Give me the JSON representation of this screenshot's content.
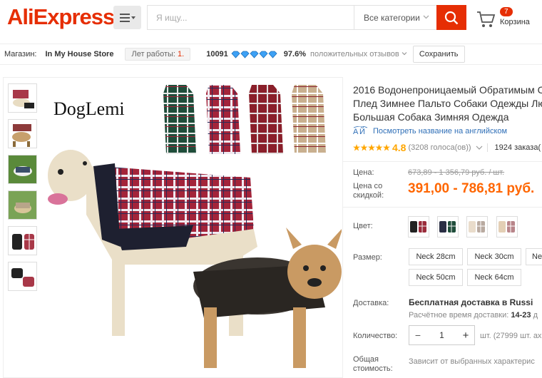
{
  "header": {
    "logo": "AliExpress",
    "logo_tm": "®",
    "search": {
      "placeholder": "Я ищу...",
      "category": "Все категории"
    },
    "cart": {
      "count": "7",
      "label": "Корзина"
    },
    "brand_color": "#e62e04"
  },
  "store": {
    "label": "Магазин:",
    "name": "In My House Store",
    "years_label": "Лет работы:",
    "years_value": "1",
    "score": "10091",
    "feedback_pct": "97.6%",
    "feedback_label": "положительных отзывов",
    "save": "Сохранить"
  },
  "gallery": {
    "brand_text": "DogLemi"
  },
  "product": {
    "title_lines": [
      "2016 Водонепроницаемый Обратимым С",
      "Плед Зимнее Пальто Собаки Одежды Лю",
      "Большая Собака Зимняя Одежда"
    ],
    "translate": "Посмотреть название на английском",
    "rating": "4.8",
    "votes": "(3208 голоса(ов))",
    "orders": "1924 заказа(",
    "price_label": "Цена:",
    "price_old": "673,89 - 1 356,79 руб. / шт.",
    "discount_label": "Цена со скидкой:",
    "price_new": "391,00 - 786,81 руб."
  },
  "options": {
    "color_label": "Цвет:",
    "size_label": "Размер:",
    "sizes": [
      "Neck 28cm",
      "Neck 30cm",
      "Ne",
      "Neck 50cm",
      "Neck 64cm"
    ],
    "shipping_label": "Доставка:",
    "shipping_value": "Бесплатная доставка в Russi",
    "shipping_sub": "Расчётное время доставки:",
    "shipping_days": "14-23",
    "shipping_tail": "д",
    "qty_label": "Количество:",
    "qty_minus": "−",
    "qty_value": "1",
    "qty_plus": "+",
    "qty_note": "шт. (27999 шт. ах",
    "total_label": "Общая стоимость:",
    "total_note": "Зависит от выбранных характерис"
  }
}
